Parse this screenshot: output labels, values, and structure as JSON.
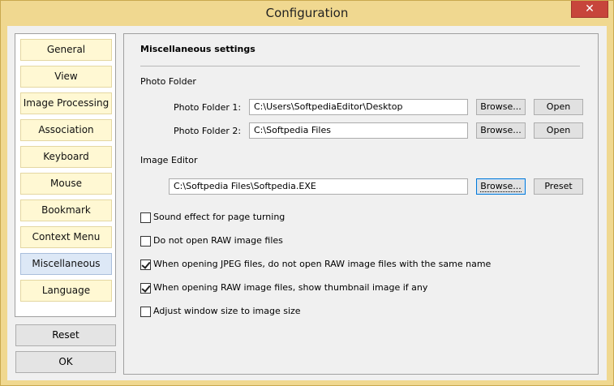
{
  "window": {
    "title": "Configuration",
    "close_label": "✕"
  },
  "nav": {
    "items": [
      {
        "label": "General"
      },
      {
        "label": "View"
      },
      {
        "label": "Image Processing"
      },
      {
        "label": "Association"
      },
      {
        "label": "Keyboard"
      },
      {
        "label": "Mouse"
      },
      {
        "label": "Bookmark"
      },
      {
        "label": "Context Menu"
      },
      {
        "label": "Miscellaneous"
      },
      {
        "label": "Language"
      }
    ],
    "selected": "Miscellaneous"
  },
  "side_buttons": {
    "reset": "Reset",
    "ok": "OK"
  },
  "panel": {
    "heading": "Miscellaneous settings",
    "photo_folder": {
      "group_label": "Photo Folder",
      "folder1_label": "Photo Folder 1:",
      "folder1_value": "C:\\Users\\SoftpediaEditor\\Desktop",
      "folder2_label": "Photo Folder 2:",
      "folder2_value": "C:\\Softpedia Files",
      "browse_label": "Browse...",
      "open_label": "Open"
    },
    "image_editor": {
      "group_label": "Image Editor",
      "value": "C:\\Softpedia Files\\Softpedia.EXE",
      "browse_label": "Browse...",
      "preset_label": "Preset"
    },
    "options": [
      {
        "label": "Sound effect for page turning",
        "checked": false
      },
      {
        "label": "Do not open RAW image files",
        "checked": false
      },
      {
        "label": "When opening JPEG files, do not open RAW image files with the same name",
        "checked": true
      },
      {
        "label": "When opening RAW image files, show thumbnail image if any",
        "checked": true
      },
      {
        "label": "Adjust window size to image size",
        "checked": false
      }
    ]
  }
}
